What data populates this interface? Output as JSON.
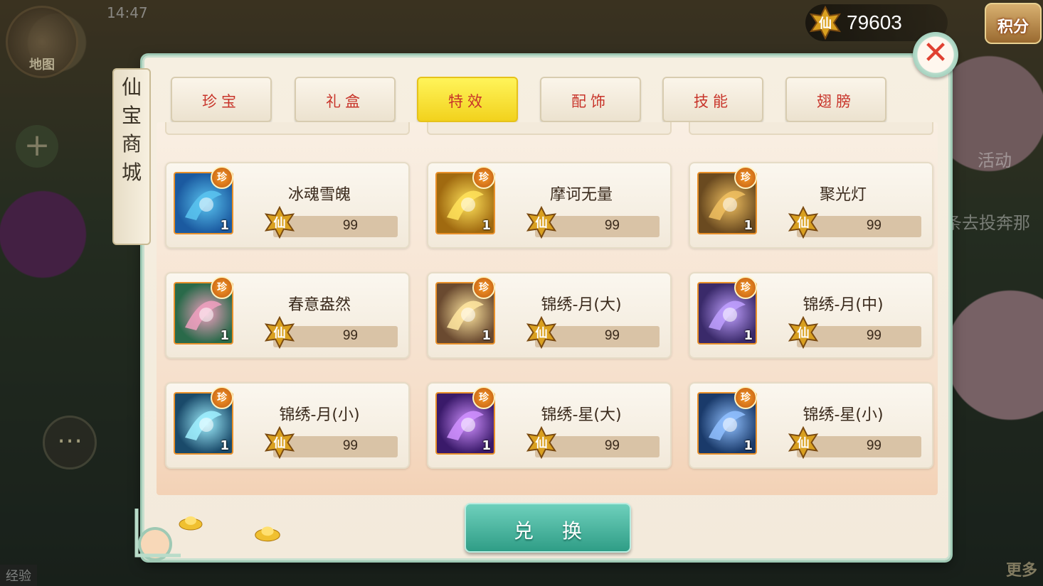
{
  "hud": {
    "map_label": "地图",
    "clock": "14:47",
    "currency_amount": "79603",
    "points_label": "积分",
    "activity_label": "活动",
    "quest_text": "条去投奔那",
    "more_label": "更多",
    "exp_label": "经验"
  },
  "shop": {
    "title_chars": [
      "仙",
      "宝",
      "商",
      "城"
    ],
    "tabs": [
      {
        "label": "珍宝",
        "active": false
      },
      {
        "label": "礼盒",
        "active": false
      },
      {
        "label": "特效",
        "active": true
      },
      {
        "label": "配饰",
        "active": false
      },
      {
        "label": "技能",
        "active": false
      },
      {
        "label": "翅膀",
        "active": false
      }
    ],
    "rare_badge": "珍",
    "currency_glyph": "仙",
    "items": [
      {
        "name": "冰魂雪魄",
        "price": "99",
        "qty": "1",
        "icon": "ice-butterfly-icon",
        "colors": [
          "#1b5aa0",
          "#5ac4f0"
        ]
      },
      {
        "name": "摩诃无量",
        "price": "99",
        "qty": "1",
        "icon": "golden-ring-icon",
        "colors": [
          "#a06a10",
          "#ffe25a"
        ]
      },
      {
        "name": "聚光灯",
        "price": "99",
        "qty": "1",
        "icon": "spotlight-icon",
        "colors": [
          "#6a4a20",
          "#f0c060"
        ]
      },
      {
        "name": "春意盎然",
        "price": "99",
        "qty": "1",
        "icon": "spring-flowers-icon",
        "colors": [
          "#2a6a4a",
          "#f0a0c0"
        ]
      },
      {
        "name": "锦绣-月(大)",
        "price": "99",
        "qty": "1",
        "icon": "crescent-moon-gold-icon",
        "colors": [
          "#6a4a30",
          "#ffe6a0"
        ]
      },
      {
        "name": "锦绣-月(中)",
        "price": "99",
        "qty": "1",
        "icon": "crescent-moon-purple-icon",
        "colors": [
          "#3a2a6a",
          "#c0a0ff"
        ]
      },
      {
        "name": "锦绣-月(小)",
        "price": "99",
        "qty": "1",
        "icon": "crescent-moon-cyan-icon",
        "colors": [
          "#1a4a6a",
          "#a0f0ff"
        ]
      },
      {
        "name": "锦绣-星(大)",
        "price": "99",
        "qty": "1",
        "icon": "star-orb-purple-icon",
        "colors": [
          "#3a1a6a",
          "#d090ff"
        ]
      },
      {
        "name": "锦绣-星(小)",
        "price": "99",
        "qty": "1",
        "icon": "star-orb-blue-icon",
        "colors": [
          "#1a3a6a",
          "#90c0ff"
        ]
      }
    ],
    "exchange_label": "兑换"
  }
}
